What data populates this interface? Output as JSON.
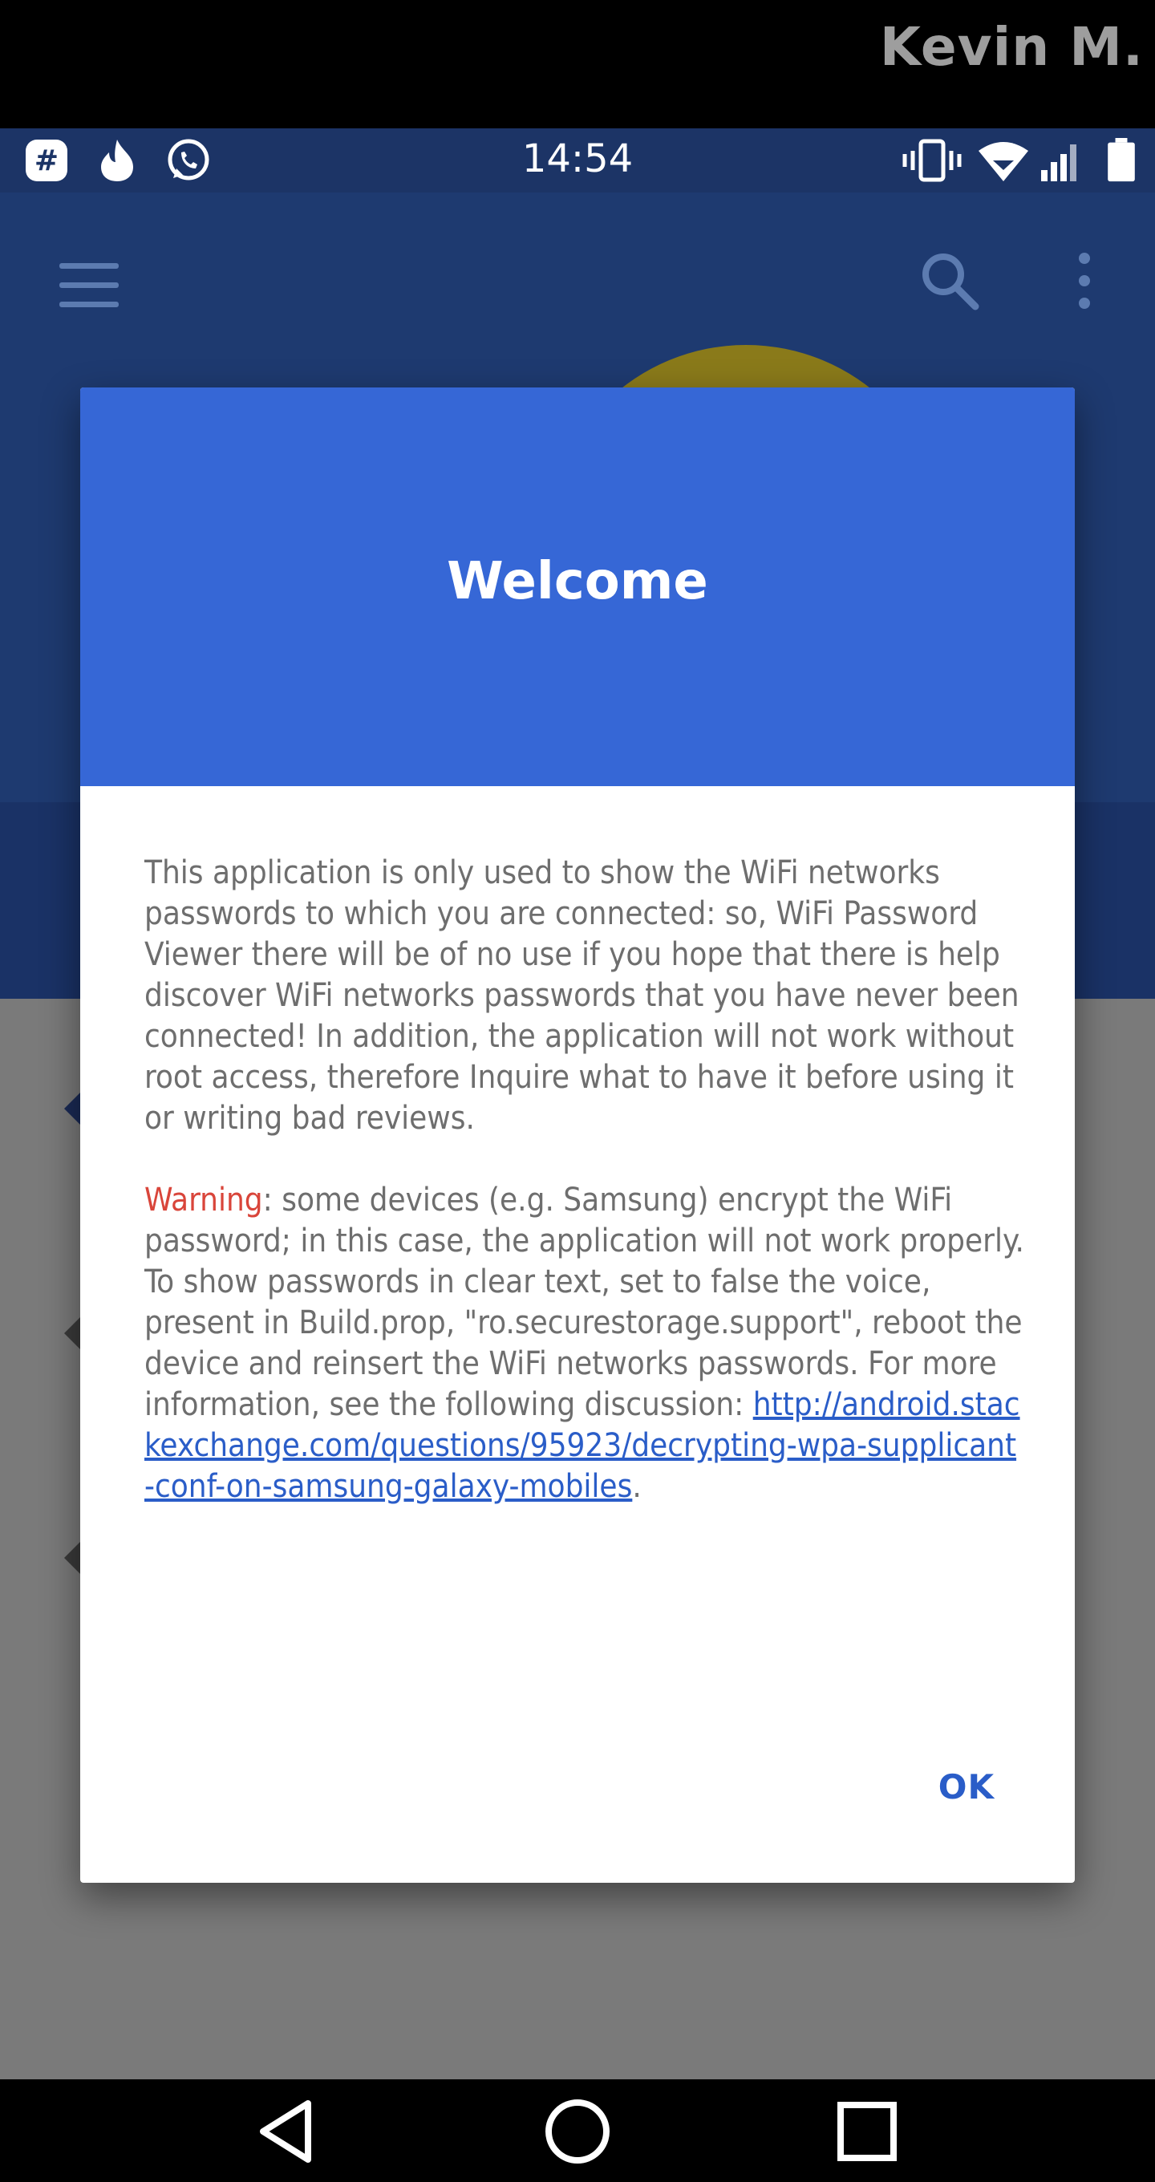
{
  "banner": {
    "user_label": "Kevin M."
  },
  "status_bar": {
    "time": "14:54",
    "left_icons": [
      "slack-icon",
      "flame-icon",
      "whatsapp-icon"
    ],
    "right_icons": [
      "vibrate-icon",
      "wifi-icon",
      "signal-icon",
      "battery-icon"
    ]
  },
  "app_toolbar": {
    "icons": [
      "menu-icon",
      "search-icon",
      "more-vert-icon"
    ]
  },
  "dialog": {
    "title": "Welcome",
    "paragraph1": "This application is only used to show the WiFi networks passwords to which you are connected: so, WiFi Password Viewer there will be of no use if you hope that there is help discover WiFi networks passwords that you have never been connected! In addition, the application will not work without root access, therefore Inquire what to have it before using it or writing bad reviews.",
    "warning_label": "Warning",
    "paragraph2": ": some devices (e.g. Samsung) encrypt the WiFi password; in this case, the application will not work properly. To show passwords in clear text, set to false the voice, present in Build.prop, \"ro.securestorage.support\", reboot the device and reinsert the WiFi networks passwords. For more information, see the following discussion: ",
    "link": "http://android.stackexchange.com/questions/95923/decrypting-wpa-supplicant-conf-on-samsung-galaxy-mobiles",
    "link_suffix": ".",
    "ok_label": "OK"
  },
  "colors": {
    "dialog_header": "#3667d6",
    "app_header": "#1e3a70",
    "warning": "#d9453a",
    "link": "#2a5dc8"
  },
  "nav_bar": {
    "icons": [
      "back-icon",
      "home-icon",
      "recents-icon"
    ]
  }
}
